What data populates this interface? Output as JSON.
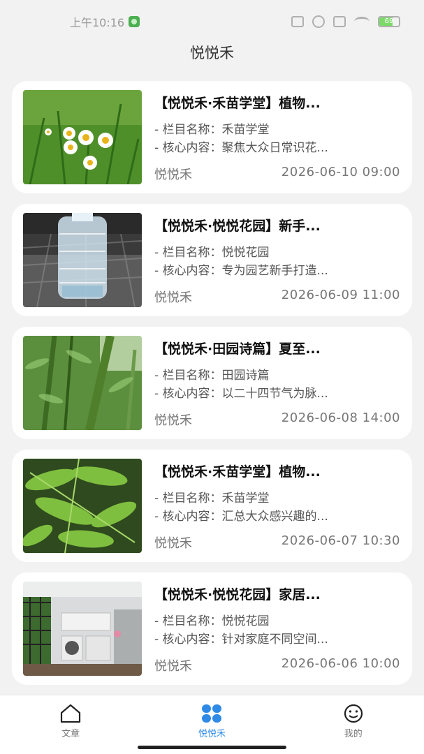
{
  "status_bar": {
    "time": "上午10:16",
    "battery": "69"
  },
  "page": {
    "title": "悦悦禾"
  },
  "articles": [
    {
      "title": "【悦悦禾·禾苗学堂】植物...",
      "column": "- 栏目名称：禾苗学堂",
      "content": "- 核心内容：聚焦大众日常识花...",
      "author": "悦悦禾",
      "date": "2026-06-10 09:00"
    },
    {
      "title": "【悦悦禾·悦悦花园】新手...",
      "column": "- 栏目名称：悦悦花园",
      "content": "- 核心内容：专为园艺新手打造...",
      "author": "悦悦禾",
      "date": "2026-06-09 11:00"
    },
    {
      "title": "【悦悦禾·田园诗篇】夏至...",
      "column": "- 栏目名称：田园诗篇",
      "content": "- 核心内容：以二十四节气为脉...",
      "author": "悦悦禾",
      "date": "2026-06-08 14:00"
    },
    {
      "title": "【悦悦禾·禾苗学堂】植物...",
      "column": "- 栏目名称：禾苗学堂",
      "content": "- 核心内容：汇总大众感兴趣的...",
      "author": "悦悦禾",
      "date": "2026-06-07 10:30"
    },
    {
      "title": "【悦悦禾·悦悦花园】家居...",
      "column": "- 栏目名称：悦悦花园",
      "content": "- 核心内容：针对家庭不同空间...",
      "author": "悦悦禾",
      "date": "2026-06-06 10:00"
    }
  ],
  "tabbar": {
    "tabs": [
      {
        "label": "文章",
        "icon": "home-icon"
      },
      {
        "label": "悦悦禾",
        "icon": "four-leaf-icon"
      },
      {
        "label": "我的",
        "icon": "smiley-icon"
      }
    ]
  },
  "colors": {
    "accent": "#2e8ae6",
    "background": "#f2f2f2",
    "card": "#ffffff"
  }
}
